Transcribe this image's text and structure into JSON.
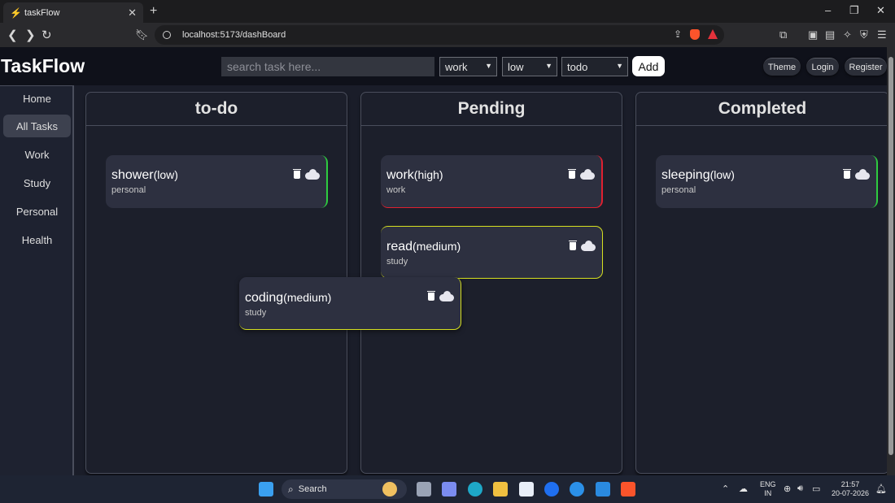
{
  "browser": {
    "tab_title": "taskFlow",
    "tab_close": "✕",
    "new_tab": "+",
    "url": "localhost:5173/dashBoard",
    "minimize": "–",
    "restore": "❐",
    "close": "✕"
  },
  "header": {
    "logo": "TaskFlow",
    "search_placeholder": "search task here...",
    "category_select": "work",
    "priority_select": "low",
    "status_select": "todo",
    "add_label": "Add",
    "theme_label": "Theme",
    "login_label": "Login",
    "register_label": "Register"
  },
  "sidebar": {
    "items": [
      {
        "label": "Home"
      },
      {
        "label": "All Tasks",
        "active": true
      },
      {
        "label": "Work"
      },
      {
        "label": "Study"
      },
      {
        "label": "Personal"
      },
      {
        "label": "Health"
      }
    ]
  },
  "columns": [
    {
      "title": "to-do"
    },
    {
      "title": "Pending"
    },
    {
      "title": "Completed"
    }
  ],
  "cards": {
    "shower": {
      "title": "shower",
      "priority": "(low)",
      "category": "personal",
      "border_color": "#2ecc40"
    },
    "work": {
      "title": "work",
      "priority": "(high)",
      "category": "work",
      "border_color": "#e02030"
    },
    "read": {
      "title": "read",
      "priority": "(medium)",
      "category": "study",
      "border_color": "#d6e020"
    },
    "coding": {
      "title": "coding",
      "priority": "(medium)",
      "category": "study",
      "border_color": "#d6e020"
    },
    "sleeping": {
      "title": "sleeping",
      "priority": "(low)",
      "category": "personal",
      "border_color": "#2ecc40"
    }
  },
  "taskbar": {
    "search_label": "Search",
    "lang_top": "ENG",
    "lang_bottom": "IN",
    "time": "21:57",
    "date": "20-07-2026"
  }
}
